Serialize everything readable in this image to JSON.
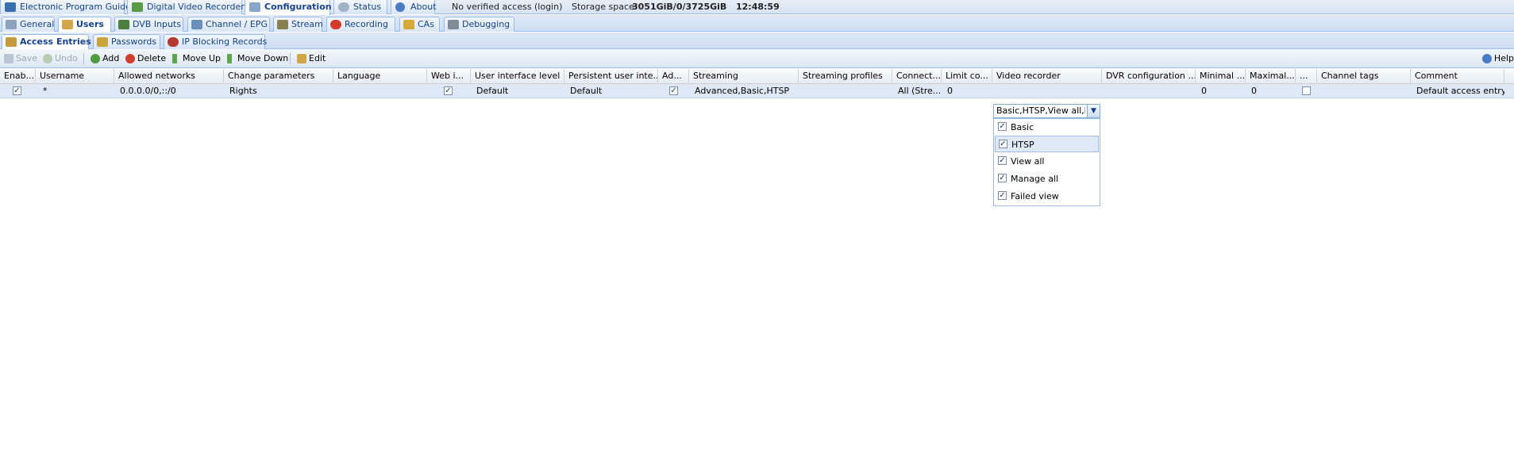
{
  "top_tabs": [
    {
      "label": "Electronic Program Guide"
    },
    {
      "label": "Digital Video Recorder"
    },
    {
      "label": "Configuration"
    },
    {
      "label": "Status"
    },
    {
      "label": "About"
    }
  ],
  "status": {
    "access": "No verified access",
    "login": "(login)",
    "storage_label": "Storage space:",
    "storage_value": "3051GiB/0/3725GiB",
    "time": "12:48:59"
  },
  "config_tabs": [
    {
      "label": "General"
    },
    {
      "label": "Users"
    },
    {
      "label": "DVB Inputs"
    },
    {
      "label": "Channel / EPG"
    },
    {
      "label": "Stream"
    },
    {
      "label": "Recording"
    },
    {
      "label": "CAs"
    },
    {
      "label": "Debugging"
    }
  ],
  "user_tabs": [
    {
      "label": "Access Entries"
    },
    {
      "label": "Passwords"
    },
    {
      "label": "IP Blocking Records"
    }
  ],
  "toolbar": {
    "save": "Save",
    "undo": "Undo",
    "add": "Add",
    "delete": "Delete",
    "move_up": "Move Up",
    "move_down": "Move Down",
    "edit": "Edit",
    "help": "Help"
  },
  "columns": [
    "Enab...",
    "Username",
    "Allowed networks",
    "Change parameters",
    "Language",
    "Web i...",
    "User interface level",
    "Persistent user inte...",
    "Ad...",
    "Streaming",
    "Streaming profiles",
    "Connect...",
    "Limit co...",
    "Video recorder",
    "DVR configuration ...",
    "Minimal ...",
    "Maximal...",
    "...",
    "Channel tags",
    "Comment"
  ],
  "row": {
    "enabled": true,
    "username": "*",
    "allowed_networks": "0.0.0.0/0,::/0",
    "change_parameters": "Rights",
    "language": "",
    "web_interface": true,
    "ui_level": "Default",
    "persistent_ui": "Default",
    "admin": true,
    "streaming": "Advanced,Basic,HTSP",
    "streaming_profiles": "",
    "connections": "All (Stre...",
    "limit_connections": "0",
    "dvr_config": "",
    "minimal": "0",
    "maximal": "0",
    "misc_checkbox": false,
    "channel_tags": "",
    "comment": "Default access entry"
  },
  "video_recorder_editor": {
    "value": "Basic,HTSP,View all,M",
    "options": [
      {
        "label": "Basic",
        "checked": true
      },
      {
        "label": "HTSP",
        "checked": true
      },
      {
        "label": "View all",
        "checked": true
      },
      {
        "label": "Manage all",
        "checked": true
      },
      {
        "label": "Failed view",
        "checked": true
      }
    ]
  },
  "colors": {
    "accent": "#15428b",
    "header_border": "#99bbe8",
    "row_selected": "#dfe8f6"
  }
}
